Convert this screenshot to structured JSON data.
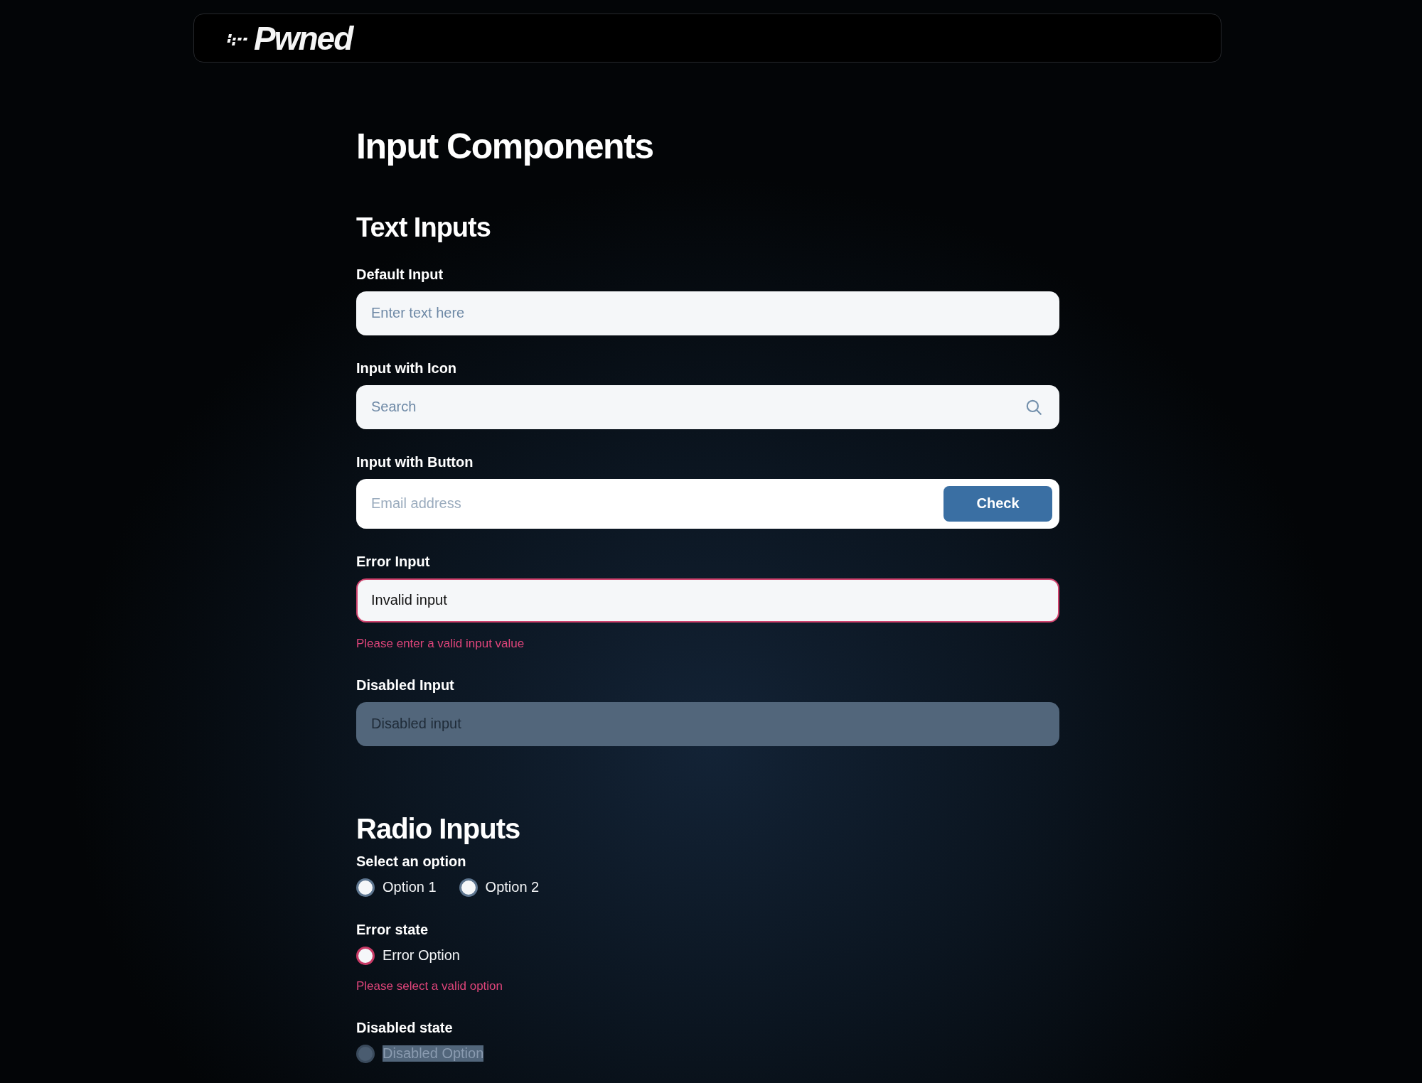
{
  "header": {
    "logo_text": "Pwned"
  },
  "title": "Input Components",
  "text_inputs": {
    "heading": "Text Inputs",
    "fields": [
      {
        "kind": "plain",
        "label": "Default Input",
        "placeholder": "Enter text here",
        "invalid": false,
        "disabled": false
      },
      {
        "kind": "icon",
        "label": "Input with Icon",
        "placeholder": "Search",
        "invalid": false,
        "disabled": false
      },
      {
        "kind": "button",
        "label": "Input with Button",
        "placeholder": "Email address",
        "button": "Check",
        "invalid": false,
        "disabled": false
      },
      {
        "kind": "plain",
        "label": "Error Input",
        "value": "Invalid input",
        "invalid": true,
        "disabled": false,
        "error_message": "Please enter a valid input value"
      },
      {
        "kind": "plain",
        "label": "Disabled Input",
        "placeholder": "Disabled input",
        "invalid": false,
        "disabled": true
      }
    ]
  },
  "radio_inputs": {
    "heading": "Radio Inputs",
    "groups": [
      {
        "kind": "normal",
        "label": "Select an option",
        "options": [
          {
            "label": "Option 1",
            "selected": false,
            "disabled": false
          },
          {
            "label": "Option 2",
            "selected": false,
            "disabled": false
          }
        ]
      },
      {
        "kind": "error",
        "label": "Error state",
        "options": [
          {
            "label": "Error Option",
            "selected": false,
            "disabled": false
          }
        ],
        "error_message": "Please select a valid option"
      },
      {
        "kind": "normal",
        "label": "Disabled state",
        "options": [
          {
            "label": "Disabled Option",
            "selected": false,
            "disabled": true
          }
        ]
      }
    ]
  }
}
